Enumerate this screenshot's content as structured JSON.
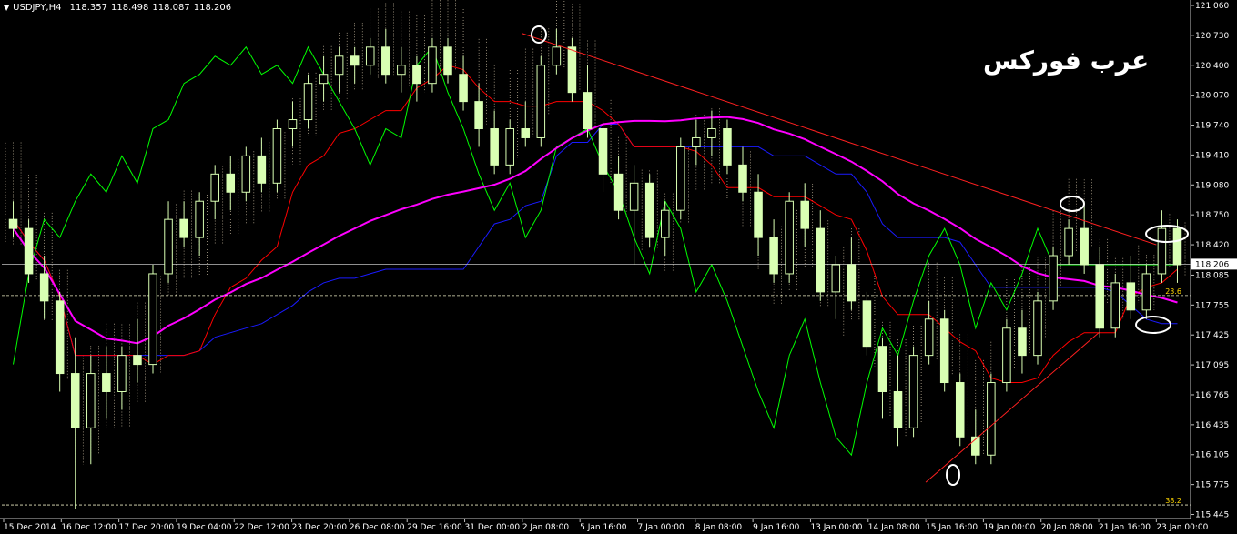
{
  "header": {
    "symbol": "USDJPY,H4",
    "ohlc": [
      "118.357",
      "118.498",
      "118.087",
      "118.206"
    ]
  },
  "watermark": "عرب فوركس",
  "chart_data": {
    "type": "candlestick",
    "y_ticks": [
      "121.060",
      "120.730",
      "120.400",
      "120.070",
      "119.740",
      "119.410",
      "119.080",
      "118.750",
      "118.420",
      "118.085",
      "117.755",
      "117.425",
      "117.095",
      "116.765",
      "116.435",
      "116.105",
      "115.775",
      "115.445"
    ],
    "y_tick_values": [
      121.06,
      120.73,
      120.4,
      120.07,
      119.74,
      119.41,
      119.08,
      118.75,
      118.42,
      118.085,
      117.755,
      117.425,
      117.095,
      116.765,
      116.435,
      116.105,
      115.775,
      115.445
    ],
    "ylim": [
      115.4,
      121.1
    ],
    "current_price": {
      "label": "118.206",
      "value": 118.206
    },
    "fib_levels": [
      {
        "label": "23.6",
        "value": 117.86
      },
      {
        "label": "38.2",
        "value": 115.55
      }
    ],
    "x_labels": [
      "15 Dec 2014",
      "16 Dec 12:00",
      "17 Dec 20:00",
      "19 Dec 04:00",
      "22 Dec 12:00",
      "23 Dec 20:00",
      "26 Dec 08:00",
      "29 Dec 16:00",
      "31 Dec 00:00",
      "2 Jan 08:00",
      "5 Jan 16:00",
      "7 Jan 00:00",
      "8 Jan 08:00",
      "9 Jan 16:00",
      "13 Jan 00:00",
      "14 Jan 08:00",
      "15 Jan 16:00",
      "19 Jan 00:00",
      "20 Jan 08:00",
      "21 Jan 16:00",
      "23 Jan 00:00"
    ],
    "colors": {
      "background": "#000000",
      "candle": "#d9ffb3",
      "tenkan": "#ff0000",
      "kijun": "#1a1aff",
      "chikou": "#00ff00",
      "ma": "#ff00ff",
      "cloud": "#f0e0c0",
      "trend": "#ff2020",
      "price_line": "#c0c0c0"
    },
    "candles_ohlc": [
      [
        118.7,
        118.9,
        118.5,
        118.6
      ],
      [
        118.6,
        118.7,
        118.0,
        118.1
      ],
      [
        118.1,
        118.3,
        117.6,
        117.8
      ],
      [
        117.8,
        117.9,
        116.8,
        117.0
      ],
      [
        117.0,
        117.4,
        115.5,
        116.4
      ],
      [
        116.4,
        117.2,
        116.0,
        117.0
      ],
      [
        117.0,
        117.3,
        116.5,
        116.8
      ],
      [
        116.8,
        117.3,
        116.6,
        117.2
      ],
      [
        117.2,
        117.6,
        116.9,
        117.1
      ],
      [
        117.1,
        118.2,
        117.0,
        118.1
      ],
      [
        118.1,
        118.9,
        118.0,
        118.7
      ],
      [
        118.7,
        118.9,
        118.4,
        118.5
      ],
      [
        118.5,
        119.0,
        118.3,
        118.9
      ],
      [
        118.9,
        119.3,
        118.7,
        119.2
      ],
      [
        119.2,
        119.4,
        118.8,
        119.0
      ],
      [
        119.0,
        119.5,
        118.9,
        119.4
      ],
      [
        119.4,
        119.6,
        119.0,
        119.1
      ],
      [
        119.1,
        119.8,
        119.0,
        119.7
      ],
      [
        119.7,
        120.0,
        119.5,
        119.8
      ],
      [
        119.8,
        120.3,
        119.7,
        120.2
      ],
      [
        120.2,
        120.5,
        120.0,
        120.3
      ],
      [
        120.3,
        120.6,
        120.1,
        120.5
      ],
      [
        120.5,
        120.6,
        120.2,
        120.4
      ],
      [
        120.4,
        120.7,
        120.3,
        120.6
      ],
      [
        120.6,
        120.8,
        120.2,
        120.3
      ],
      [
        120.3,
        120.6,
        120.1,
        120.4
      ],
      [
        120.4,
        120.5,
        120.0,
        120.2
      ],
      [
        120.2,
        120.7,
        120.1,
        120.6
      ],
      [
        120.6,
        120.7,
        120.2,
        120.3
      ],
      [
        120.3,
        120.5,
        119.9,
        120.0
      ],
      [
        120.0,
        120.2,
        119.5,
        119.7
      ],
      [
        119.7,
        119.9,
        119.2,
        119.3
      ],
      [
        119.3,
        119.8,
        119.2,
        119.7
      ],
      [
        119.7,
        120.0,
        119.5,
        119.6
      ],
      [
        119.6,
        120.5,
        119.5,
        120.4
      ],
      [
        120.4,
        120.8,
        120.3,
        120.6
      ],
      [
        120.6,
        120.7,
        120.0,
        120.1
      ],
      [
        120.1,
        120.4,
        119.6,
        119.7
      ],
      [
        119.7,
        119.8,
        119.0,
        119.2
      ],
      [
        119.2,
        119.4,
        118.7,
        118.8
      ],
      [
        118.8,
        119.3,
        118.2,
        119.1
      ],
      [
        119.1,
        119.2,
        118.4,
        118.5
      ],
      [
        118.5,
        118.9,
        118.3,
        118.8
      ],
      [
        118.8,
        119.6,
        118.7,
        119.5
      ],
      [
        119.5,
        119.8,
        119.3,
        119.6
      ],
      [
        119.6,
        119.9,
        119.4,
        119.7
      ],
      [
        119.7,
        119.8,
        119.2,
        119.3
      ],
      [
        119.3,
        119.5,
        118.9,
        119.0
      ],
      [
        119.0,
        119.2,
        118.3,
        118.5
      ],
      [
        118.5,
        118.7,
        118.0,
        118.1
      ],
      [
        118.1,
        119.0,
        118.0,
        118.9
      ],
      [
        118.9,
        119.1,
        118.4,
        118.6
      ],
      [
        118.6,
        118.8,
        117.8,
        117.9
      ],
      [
        117.9,
        118.3,
        117.6,
        118.2
      ],
      [
        118.2,
        118.5,
        117.7,
        117.8
      ],
      [
        117.8,
        117.9,
        117.2,
        117.3
      ],
      [
        117.3,
        117.4,
        116.5,
        116.8
      ],
      [
        116.8,
        117.2,
        116.2,
        116.4
      ],
      [
        116.4,
        117.3,
        116.3,
        117.2
      ],
      [
        117.2,
        117.8,
        117.1,
        117.6
      ],
      [
        117.6,
        117.7,
        116.8,
        116.9
      ],
      [
        116.9,
        117.0,
        116.2,
        116.3
      ],
      [
        116.3,
        116.6,
        116.0,
        116.1
      ],
      [
        116.1,
        117.0,
        116.0,
        116.9
      ],
      [
        116.9,
        117.6,
        116.8,
        117.5
      ],
      [
        117.5,
        117.7,
        117.0,
        117.2
      ],
      [
        117.2,
        117.9,
        117.1,
        117.8
      ],
      [
        117.8,
        118.4,
        117.7,
        118.3
      ],
      [
        118.3,
        118.7,
        118.2,
        118.6
      ],
      [
        118.6,
        118.9,
        118.1,
        118.2
      ],
      [
        118.2,
        118.4,
        117.4,
        117.5
      ],
      [
        117.5,
        118.1,
        117.4,
        118.0
      ],
      [
        118.0,
        118.3,
        117.6,
        117.7
      ],
      [
        117.7,
        118.2,
        117.6,
        118.1
      ],
      [
        118.1,
        118.8,
        118.0,
        118.6
      ],
      [
        118.6,
        118.7,
        118.0,
        118.2
      ]
    ],
    "trendlines": [
      {
        "from": [
          "2 Jan 08:00",
          120.75
        ],
        "to": [
          "23 Jan 00:00",
          118.42
        ]
      },
      {
        "from": [
          "15 Jan 16:00",
          115.8
        ],
        "to": [
          "21 Jan 16:00",
          117.45
        ]
      }
    ]
  }
}
